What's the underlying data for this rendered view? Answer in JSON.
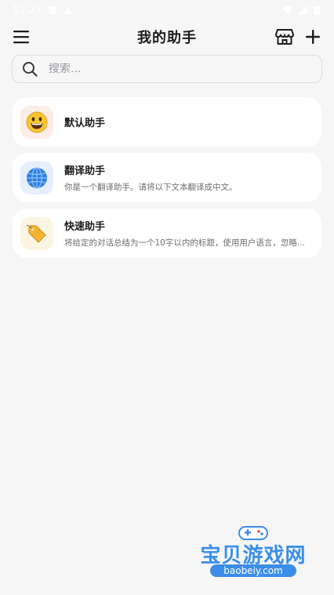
{
  "status_bar": {
    "time": "11:27"
  },
  "header": {
    "title": "我的助手"
  },
  "search": {
    "placeholder": "搜索..."
  },
  "assistants": [
    {
      "name": "默认助手",
      "desc": "",
      "icon": "smiley-emoji-icon"
    },
    {
      "name": "翻译助手",
      "desc": "你是一个翻译助手。请将以下文本翻译成中文。",
      "icon": "globe-emoji-icon"
    },
    {
      "name": "快速助手",
      "desc": "将给定的对话总结为一个10字以内的标题，使用用户语言，忽略...",
      "icon": "tag-emoji-icon"
    }
  ],
  "watermark": {
    "text": "宝贝游戏网",
    "url": "baobeiy.com"
  },
  "colors": {
    "background": "#f6f6f7",
    "card": "#ffffff",
    "accent": "#3a8ee8"
  }
}
